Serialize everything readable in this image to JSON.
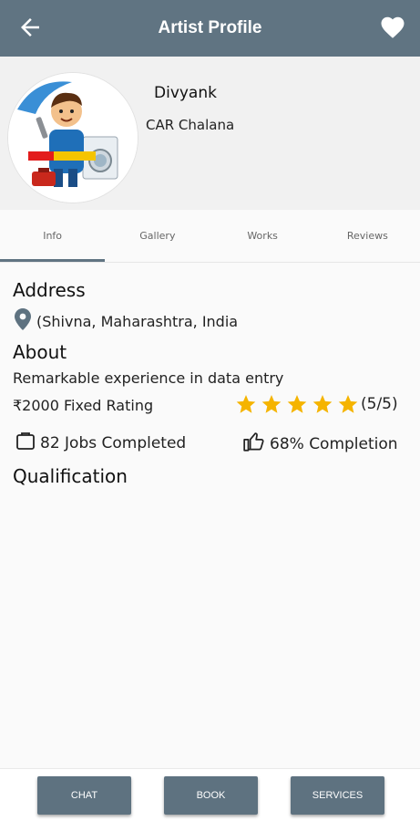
{
  "app_bar": {
    "title": "Artist Profile",
    "back_icon": "arrow-left-icon",
    "favorite_icon": "heart-icon",
    "color": "#607482"
  },
  "profile": {
    "name": "Divyank",
    "profession": "CAR Chalana",
    "avatar_icon": "mechanic-avatar"
  },
  "tabs": [
    {
      "label": "Info",
      "active": true
    },
    {
      "label": "Gallery",
      "active": false
    },
    {
      "label": "Works",
      "active": false
    },
    {
      "label": "Reviews",
      "active": false
    }
  ],
  "address": {
    "heading": "Address",
    "icon": "location-pin-icon",
    "text": "(Shivna, Maharashtra, India"
  },
  "about": {
    "heading": "About",
    "description": "Remarkable experience in data entry",
    "price_text": "₹2000 Fixed Rating",
    "rating_stars": 5,
    "rating_text": "(5/5)",
    "star_color": "#f5b400"
  },
  "stats": {
    "jobs_icon": "briefcase-icon",
    "jobs_text": "82 Jobs Completed",
    "completion_icon": "thumbs-up-icon",
    "completion_text": "68% Completion"
  },
  "qualification": {
    "heading": "Qualification"
  },
  "actions": {
    "chat": "CHAT",
    "book": "BOOK",
    "services": "SERVICES"
  }
}
